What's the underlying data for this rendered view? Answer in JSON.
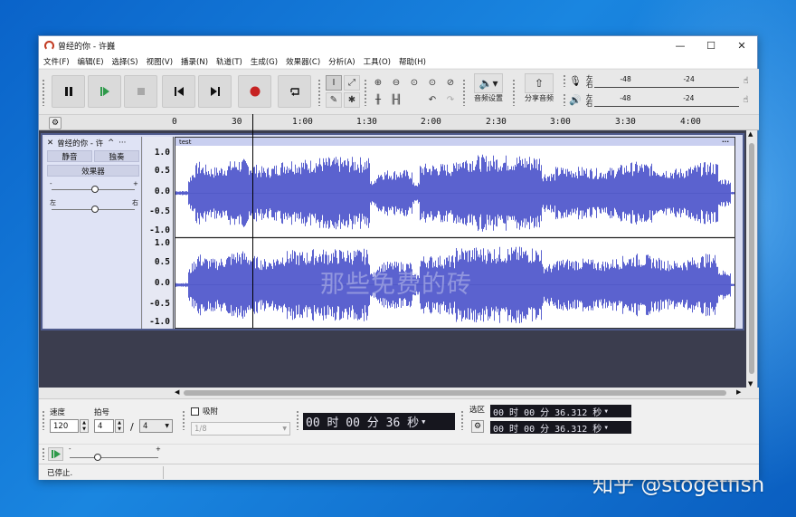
{
  "window": {
    "title": "曾经的你 - 许巍",
    "minimize": "—",
    "maximize": "☐",
    "close": "✕"
  },
  "menu": [
    "文件(F)",
    "编辑(E)",
    "选择(S)",
    "视图(V)",
    "播录(N)",
    "轨道(T)",
    "生成(G)",
    "效果器(C)",
    "分析(A)",
    "工具(O)",
    "帮助(H)"
  ],
  "toolbar": {
    "transport": [
      "pause-icon",
      "play-icon",
      "stop-icon",
      "skip-start-icon",
      "skip-end-icon",
      "record-icon",
      "loop-icon"
    ],
    "tools": [
      "select-tool-icon",
      "envelope-tool-icon",
      "draw-tool-icon",
      "multi-tool-icon"
    ],
    "zoom": [
      "zoom-in-icon",
      "zoom-out-icon",
      "fit-selection-icon",
      "fit-project-icon",
      "zoom-toggle-icon",
      "trim-icon",
      "silence-icon",
      "undo-icon",
      "redo-icon"
    ],
    "audio_setup": {
      "icon": "speaker-icon",
      "label": "音频设置"
    },
    "share_audio": {
      "icon": "share-icon",
      "label": "分享音频"
    },
    "record_meter": {
      "top_label": "左",
      "bottom_label": "右",
      "ticks": [
        "-48",
        "-24"
      ]
    },
    "play_meter": {
      "top_label": "左",
      "bottom_label": "右",
      "ticks": [
        "-48",
        "-24"
      ]
    }
  },
  "timeline": {
    "ticks": [
      "0",
      "30",
      "1:00",
      "1:30",
      "2:00",
      "2:30",
      "3:00",
      "3:30",
      "4:00"
    ]
  },
  "track": {
    "name": "曾经的你 - 许",
    "mute": "静音",
    "solo": "独奏",
    "effects": "效果器",
    "gain_minus": "-",
    "gain_plus": "+",
    "pan_left": "左",
    "pan_right": "右",
    "gain_level": 0.52,
    "pan_level": 0.52,
    "clip_name": "test",
    "scale": [
      "1.0",
      "0.5",
      "0.0",
      "-0.5",
      "-1.0"
    ],
    "channels": 2,
    "watermark": "那些免费的砖"
  },
  "bottom": {
    "tempo_label": "速度",
    "tempo_value": "120",
    "meter_label": "拍号",
    "meter_num": "4",
    "meter_sep": "/",
    "meter_den": "4",
    "snap_label": "吸附",
    "snap_value": "1/8",
    "time": "00 时 00 分 36 秒",
    "selection_label": "选区",
    "sel_start": "00 时 00 分 36.312 秒",
    "sel_end": "00 时 00 分 36.312 秒"
  },
  "playbar": {
    "minus": "-",
    "plus": "+",
    "speed_level": 0.32
  },
  "status": "已停止.",
  "desktop_watermark": "知乎 @stogetfish",
  "colors": {
    "waveform": "#5b62cf",
    "track_bg": "#dfe3f5",
    "record": "#c62222",
    "play": "#2e9a4a"
  }
}
